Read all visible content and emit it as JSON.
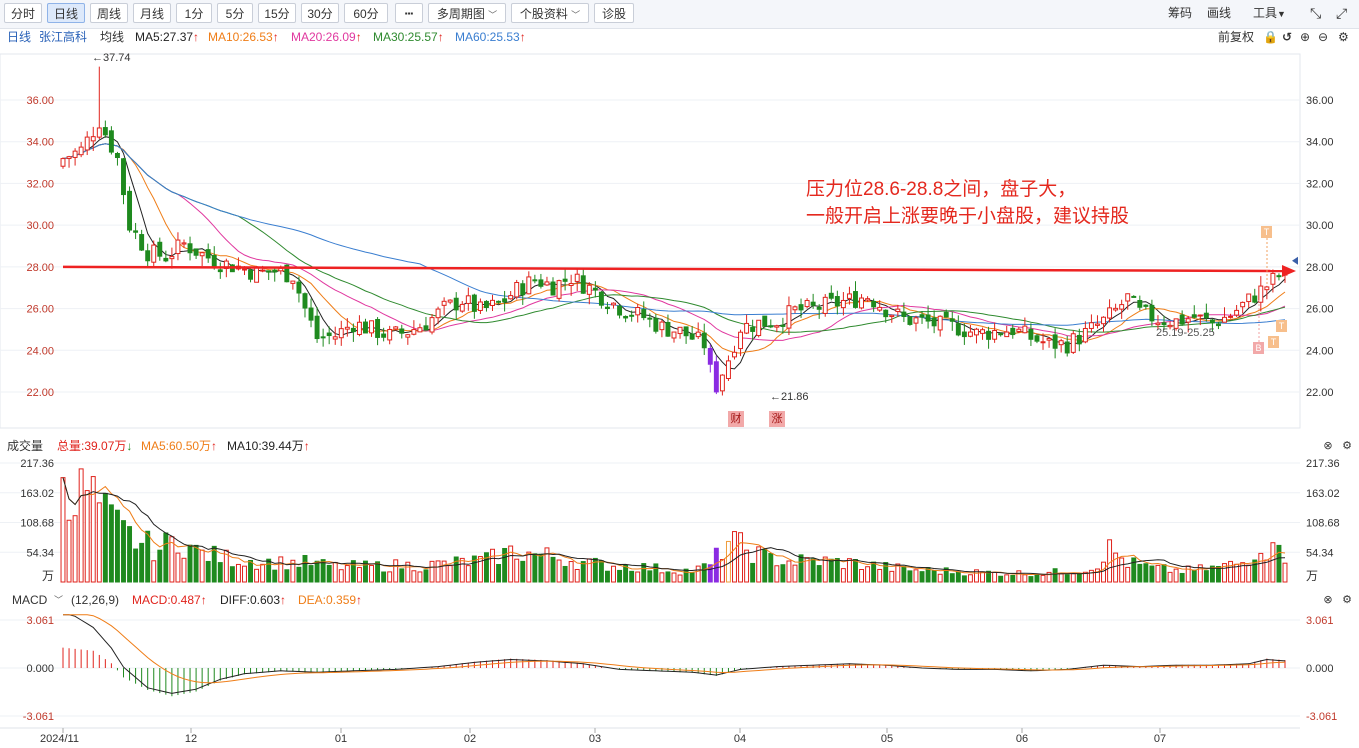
{
  "toolbar": {
    "buttons": [
      "分时",
      "日线",
      "周线",
      "月线",
      "1分",
      "5分",
      "15分",
      "30分",
      "60分"
    ],
    "active": "日线",
    "more": "▪▪▪",
    "multi_period": "多周期图",
    "stock_info": "个股资料",
    "diagnose": "诊股",
    "right": {
      "chips": "筹码",
      "draw": "画线",
      "tools": "工具"
    }
  },
  "info": {
    "period": "日线",
    "stock_name": "张江高科",
    "avg_line": "均线",
    "ma5": "MA5:27.37",
    "ma10": "MA10:26.53",
    "ma20": "MA20:26.09",
    "ma30": "MA30:25.57",
    "ma60": "MA60:25.53",
    "adjust": "前复权"
  },
  "colors": {
    "up": "#e0231c",
    "down": "#1f8a1f",
    "ma5": "#222222",
    "ma10": "#ef7d17",
    "ma20": "#e0389f",
    "ma30": "#2f8a2f",
    "ma60": "#3a7ed0",
    "resistance": "#ee2222"
  },
  "price_axis": {
    "ticks": [
      "36.00",
      "34.00",
      "32.00",
      "30.00",
      "28.00",
      "26.00",
      "24.00",
      "22.00"
    ]
  },
  "annotations": {
    "high": "37.74",
    "low": "21.86",
    "range": "25.19-25.25",
    "note_line1": "压力位28.6-28.8之间，盘子大，",
    "note_line2": "一般开启上涨要晚于小盘股，建议持股",
    "badge_cai": "财",
    "badge_zhang": "涨",
    "mark_t": "T",
    "mark_b": "B"
  },
  "volume": {
    "title": "成交量",
    "total": "总量:39.07万",
    "ma5": "MA5:60.50万",
    "ma10": "MA10:39.44万",
    "ticks": [
      "217.36",
      "163.02",
      "108.68",
      "54.34"
    ],
    "unit": "万"
  },
  "macd": {
    "title": "MACD",
    "params": "(12,26,9)",
    "macd": "MACD:0.487",
    "diff": "DIFF:0.603",
    "dea": "DEA:0.359",
    "ticks": [
      "3.061",
      "0.000",
      "-3.061"
    ]
  },
  "x_axis": {
    "labels": [
      "2024/11",
      "12",
      "01",
      "02",
      "03",
      "04",
      "05",
      "06",
      "07"
    ]
  },
  "chart_data": {
    "type": "candlestick",
    "price_range": [
      21,
      38
    ],
    "volume_range": [
      0,
      230
    ],
    "macd_range": [
      -3.6,
      3.6
    ],
    "resistance": {
      "from": 28.0,
      "to": 27.8
    },
    "keypoints": [
      [
        0,
        33.2
      ],
      [
        3,
        33.6
      ],
      [
        6,
        35.0
      ],
      [
        9,
        33.2
      ],
      [
        11,
        30.0
      ],
      [
        14,
        28.7
      ],
      [
        17,
        28.5
      ],
      [
        20,
        29.1
      ],
      [
        23,
        28.6
      ],
      [
        26,
        28.2
      ],
      [
        29,
        28.0
      ],
      [
        32,
        27.7
      ],
      [
        35,
        27.8
      ],
      [
        38,
        27.6
      ],
      [
        40,
        26.0
      ],
      [
        42,
        24.6
      ],
      [
        45,
        24.7
      ],
      [
        48,
        25.3
      ],
      [
        51,
        25.0
      ],
      [
        54,
        24.7
      ],
      [
        57,
        24.9
      ],
      [
        60,
        25.3
      ],
      [
        63,
        26.0
      ],
      [
        66,
        26.4
      ],
      [
        69,
        25.9
      ],
      [
        72,
        26.2
      ],
      [
        75,
        26.9
      ],
      [
        78,
        27.4
      ],
      [
        81,
        27.1
      ],
      [
        84,
        27.5
      ],
      [
        87,
        27.0
      ],
      [
        90,
        26.4
      ],
      [
        93,
        25.9
      ],
      [
        96,
        25.6
      ],
      [
        99,
        25.1
      ],
      [
        102,
        24.9
      ],
      [
        104,
        24.6
      ],
      [
        106,
        24.3
      ],
      [
        107,
        23.0
      ],
      [
        108,
        22.3
      ],
      [
        110,
        23.6
      ],
      [
        112,
        25.1
      ],
      [
        115,
        25.3
      ],
      [
        118,
        25.4
      ],
      [
        121,
        25.9
      ],
      [
        124,
        26.0
      ],
      [
        127,
        26.2
      ],
      [
        130,
        26.4
      ],
      [
        133,
        26.6
      ],
      [
        136,
        26.0
      ],
      [
        139,
        25.5
      ],
      [
        142,
        25.4
      ],
      [
        145,
        25.2
      ],
      [
        148,
        25.1
      ],
      [
        151,
        24.8
      ],
      [
        154,
        24.9
      ],
      [
        157,
        25.0
      ],
      [
        160,
        24.6
      ],
      [
        163,
        24.3
      ],
      [
        166,
        24.3
      ],
      [
        169,
        24.8
      ],
      [
        172,
        25.4
      ],
      [
        174,
        25.9
      ],
      [
        176,
        26.5
      ],
      [
        178,
        25.8
      ],
      [
        181,
        25.5
      ],
      [
        184,
        25.4
      ],
      [
        187,
        25.6
      ],
      [
        190,
        25.3
      ],
      [
        193,
        25.7
      ],
      [
        196,
        26.4
      ],
      [
        199,
        27.1
      ],
      [
        201,
        27.6
      ],
      [
        202,
        27.4
      ]
    ],
    "volume_keypoints": [
      [
        0,
        217
      ],
      [
        2,
        150
      ],
      [
        4,
        170
      ],
      [
        7,
        120
      ],
      [
        10,
        90
      ],
      [
        13,
        70
      ],
      [
        16,
        60
      ],
      [
        19,
        80
      ],
      [
        22,
        55
      ],
      [
        26,
        45
      ],
      [
        30,
        40
      ],
      [
        35,
        35
      ],
      [
        40,
        35
      ],
      [
        45,
        28
      ],
      [
        50,
        28
      ],
      [
        55,
        30
      ],
      [
        60,
        30
      ],
      [
        65,
        35
      ],
      [
        70,
        40
      ],
      [
        74,
        55
      ],
      [
        78,
        50
      ],
      [
        82,
        45
      ],
      [
        86,
        35
      ],
      [
        90,
        30
      ],
      [
        95,
        28
      ],
      [
        100,
        22
      ],
      [
        104,
        20
      ],
      [
        107,
        30
      ],
      [
        110,
        75
      ],
      [
        113,
        60
      ],
      [
        116,
        45
      ],
      [
        120,
        38
      ],
      [
        125,
        38
      ],
      [
        130,
        35
      ],
      [
        135,
        28
      ],
      [
        140,
        22
      ],
      [
        145,
        20
      ],
      [
        150,
        18
      ],
      [
        155,
        16
      ],
      [
        160,
        16
      ],
      [
        165,
        18
      ],
      [
        170,
        25
      ],
      [
        173,
        60
      ],
      [
        176,
        35
      ],
      [
        180,
        25
      ],
      [
        185,
        20
      ],
      [
        190,
        25
      ],
      [
        195,
        35
      ],
      [
        198,
        70
      ],
      [
        200,
        55
      ],
      [
        201,
        95
      ],
      [
        202,
        50
      ]
    ],
    "macd_keypoints": [
      [
        0,
        1.3
      ],
      [
        5,
        1.1
      ],
      [
        8,
        0.3
      ],
      [
        10,
        -0.6
      ],
      [
        14,
        -1.4
      ],
      [
        18,
        -1.8
      ],
      [
        22,
        -1.5
      ],
      [
        26,
        -0.8
      ],
      [
        30,
        -0.4
      ],
      [
        36,
        -0.2
      ],
      [
        42,
        -0.3
      ],
      [
        48,
        -0.2
      ],
      [
        55,
        -0.1
      ],
      [
        62,
        0.1
      ],
      [
        68,
        0.4
      ],
      [
        74,
        0.6
      ],
      [
        80,
        0.5
      ],
      [
        86,
        0.3
      ],
      [
        92,
        -0.1
      ],
      [
        98,
        -0.2
      ],
      [
        104,
        -0.3
      ],
      [
        108,
        -0.5
      ],
      [
        112,
        -0.1
      ],
      [
        118,
        0.1
      ],
      [
        124,
        0.2
      ],
      [
        130,
        0.3
      ],
      [
        136,
        0.2
      ],
      [
        142,
        0.0
      ],
      [
        148,
        -0.1
      ],
      [
        154,
        -0.1
      ],
      [
        160,
        -0.2
      ],
      [
        166,
        -0.1
      ],
      [
        172,
        0.2
      ],
      [
        178,
        0.1
      ],
      [
        184,
        0.2
      ],
      [
        190,
        0.2
      ],
      [
        196,
        0.3
      ],
      [
        199,
        0.6
      ],
      [
        202,
        0.5
      ]
    ]
  }
}
